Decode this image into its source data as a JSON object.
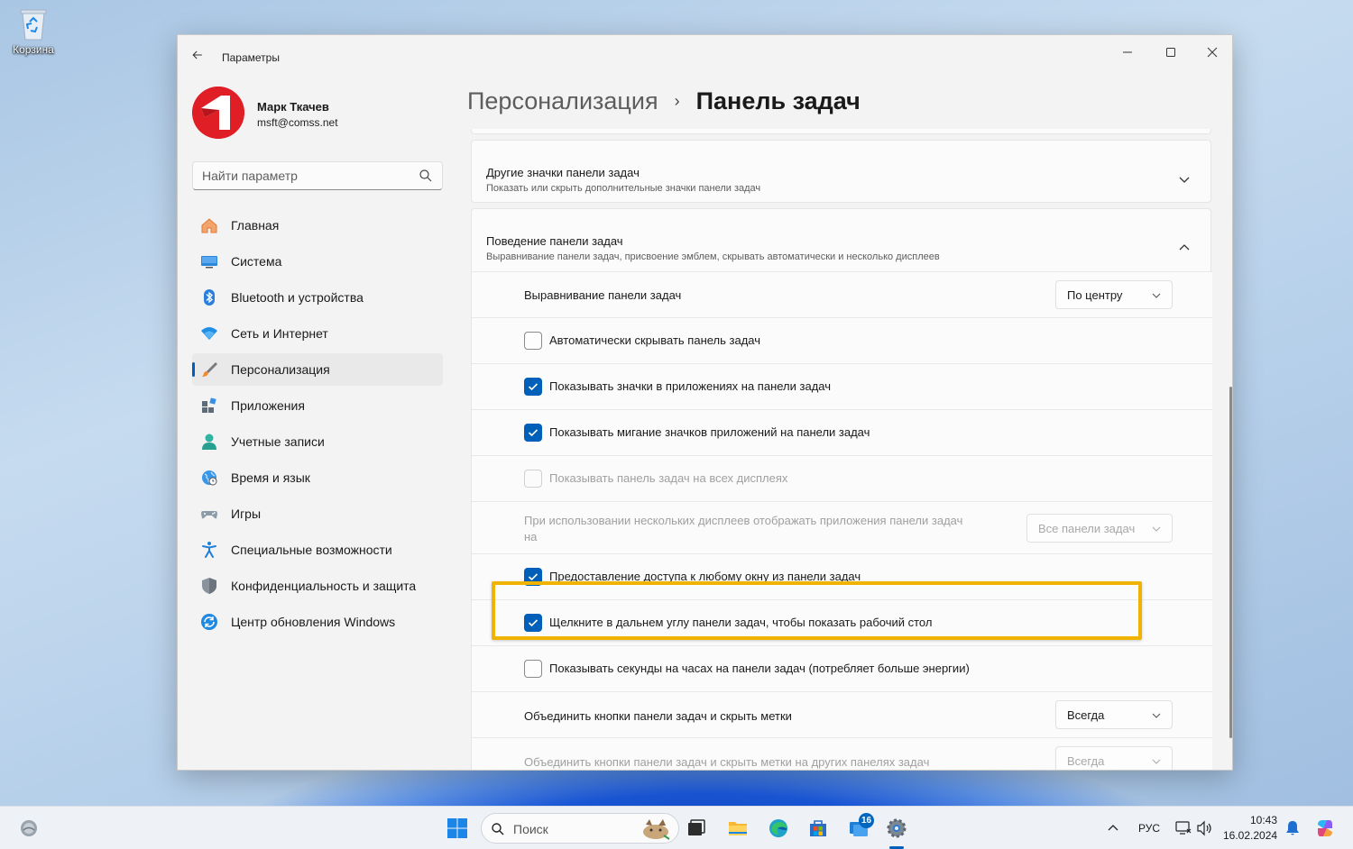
{
  "desktop": {
    "recycle_bin_label": "Корзина"
  },
  "window": {
    "title": "Параметры",
    "controls": {
      "minimize": "—",
      "maximize": "☐",
      "close": "✕"
    }
  },
  "user": {
    "name": "Марк Ткачев",
    "email": "msft@comss.net",
    "avatar_color": "#e01e26"
  },
  "search": {
    "placeholder": "Найти параметр"
  },
  "sidebar": {
    "items": [
      {
        "label": "Главная",
        "icon": "home-icon",
        "active": false
      },
      {
        "label": "Система",
        "icon": "system-icon",
        "active": false
      },
      {
        "label": "Bluetooth и устройства",
        "icon": "bluetooth-icon",
        "active": false
      },
      {
        "label": "Сеть и Интернет",
        "icon": "wifi-icon",
        "active": false
      },
      {
        "label": "Персонализация",
        "icon": "brush-icon",
        "active": true
      },
      {
        "label": "Приложения",
        "icon": "apps-icon",
        "active": false
      },
      {
        "label": "Учетные записи",
        "icon": "account-icon",
        "active": false
      },
      {
        "label": "Время и язык",
        "icon": "globe-icon",
        "active": false
      },
      {
        "label": "Игры",
        "icon": "gamepad-icon",
        "active": false
      },
      {
        "label": "Специальные возможности",
        "icon": "accessibility-icon",
        "active": false
      },
      {
        "label": "Конфиденциальность и защита",
        "icon": "shield-icon",
        "active": false
      },
      {
        "label": "Центр обновления Windows",
        "icon": "update-icon",
        "active": false
      }
    ]
  },
  "breadcrumb": {
    "parent": "Персонализация",
    "separator": "›",
    "current": "Панель задач"
  },
  "sections": {
    "other_icons": {
      "title": "Другие значки панели задач",
      "subtitle": "Показать или скрыть дополнительные значки панели задач",
      "expanded": false
    },
    "behavior": {
      "title": "Поведение панели задач",
      "subtitle": "Выравнивание панели задач, присвоение эмблем, скрывать автоматически и несколько дисплеев",
      "expanded": true
    }
  },
  "settings": {
    "alignment": {
      "label": "Выравнивание панели задач",
      "value": "По центру"
    },
    "auto_hide": {
      "label": "Автоматически скрывать панель задач",
      "checked": false,
      "disabled": false
    },
    "show_badges": {
      "label": "Показывать значки в приложениях на панели задач",
      "checked": true,
      "disabled": false
    },
    "show_flashing": {
      "label": "Показывать мигание значков приложений на панели задач",
      "checked": true,
      "disabled": false
    },
    "all_displays": {
      "label": "Показывать панель задач на всех дисплеях",
      "checked": false,
      "disabled": true
    },
    "multi_display": {
      "label_line1": "При использовании нескольких дисплеев отображать приложения панели задач",
      "label_line2": "на",
      "value": "Все панели задач",
      "disabled": true
    },
    "share_window": {
      "label": "Предоставление доступа к любому окну из панели задач",
      "checked": true,
      "disabled": false
    },
    "corner_click": {
      "label": "Щелкните в дальнем углу панели задач, чтобы показать рабочий стол",
      "checked": true,
      "disabled": false,
      "highlighted": true
    },
    "show_seconds": {
      "label": "Показывать секунды на часах на панели задач (потребляет больше энергии)",
      "checked": false,
      "disabled": false
    },
    "combine": {
      "label": "Объединить кнопки панели задач и скрыть метки",
      "value": "Всегда"
    },
    "combine_other": {
      "label": "Объединить кнопки панели задач и скрыть метки на других панелях задач",
      "value": "Всегда",
      "disabled": true
    }
  },
  "taskbar": {
    "search_placeholder": "Поиск",
    "store_badge": "16",
    "language": "РУС",
    "time": "10:43",
    "date": "16.02.2024"
  },
  "colors": {
    "accent": "#005fb8",
    "highlight_frame": "#f0b400"
  }
}
